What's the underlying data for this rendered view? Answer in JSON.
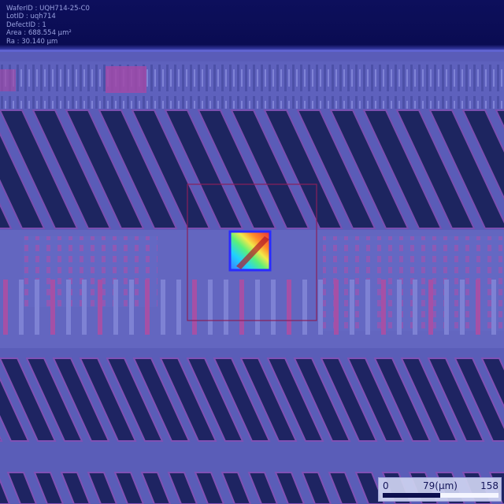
{
  "info": {
    "wafer_id": "WaferID : UQH714-25-C0",
    "lot_id": "LotID : uqh714",
    "defect_id": "DefectID : 1",
    "area": "Area : 688.554 µm²",
    "ra": "Ra : 30.140 µm"
  },
  "scale_bar": {
    "min_label": "0",
    "mid_label": "79(µm)",
    "max_label": "158"
  },
  "colors": {
    "background": "#5a5cb8",
    "trench": "#1d2560",
    "metal": "#a44ea8",
    "defect_box": "#2a2cff",
    "roi_box": "#8a1f5a"
  }
}
